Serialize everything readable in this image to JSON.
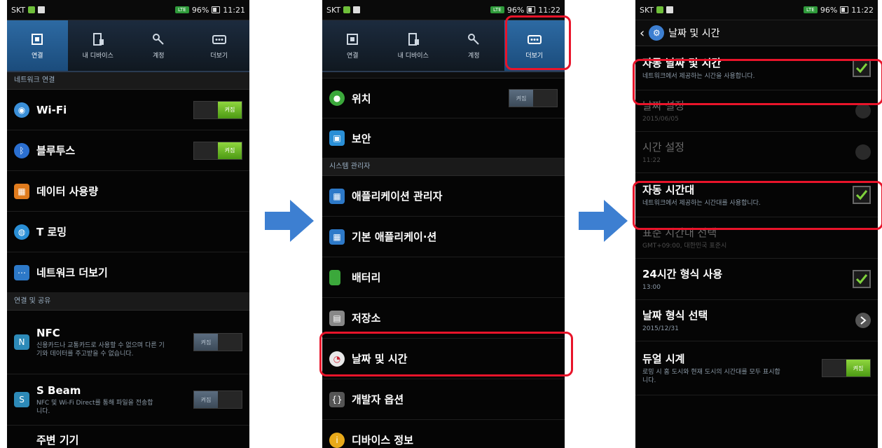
{
  "status": {
    "p1": {
      "carrier": "SKT",
      "battery": "96%",
      "time": "11:21"
    },
    "p2": {
      "carrier": "SKT",
      "battery": "96%",
      "time": "11:22"
    },
    "p3": {
      "carrier": "SKT",
      "battery": "96%",
      "time": "11:22"
    }
  },
  "tabs": [
    {
      "label": "연결",
      "icon": "connection-icon"
    },
    {
      "label": "내 디바이스",
      "icon": "device-icon"
    },
    {
      "label": "계정",
      "icon": "key-icon"
    },
    {
      "label": "더보기",
      "icon": "more-icon"
    }
  ],
  "p1": {
    "sections": [
      "네트워크 연결",
      "연결 및 공유"
    ],
    "items": [
      {
        "label": "Wi-Fi",
        "toggle": "켜짐",
        "color": "#3a8fd8"
      },
      {
        "label": "블루투스",
        "toggle": "켜짐",
        "color": "#2b6fd0"
      },
      {
        "label": "데이터 사용량",
        "color": "#e07b1d"
      },
      {
        "label": "T 로밍",
        "color": "#2a8fd6"
      },
      {
        "label": "네트워크 더보기",
        "color": "#2d79c8"
      }
    ],
    "nfc": {
      "label": "NFC",
      "sub": "신용카드나 교통카드로 사용할 수 없으며 다른 기기와 데이터를 주고받을 수 없습니다.",
      "toggle": "켜짐"
    },
    "sbeam": {
      "label": "S Beam",
      "sub": "NFC 및 Wi-Fi Direct를 통해 파일을 전송합니다.",
      "toggle": "켜짐"
    },
    "nearby": {
      "label": "주변 기기"
    }
  },
  "p2": {
    "location": {
      "label": "위치",
      "toggle": "켜짐"
    },
    "security": {
      "label": "보안"
    },
    "section": "시스템 관리자",
    "items": [
      {
        "label": "애플리케이션 관리자",
        "color": "#2d79c8"
      },
      {
        "label": "기본 애플리케이·션",
        "color": "#2d79c8"
      },
      {
        "label": "배터리",
        "color": "#3ba83b"
      },
      {
        "label": "저장소",
        "color": "#888888"
      },
      {
        "label": "날짜 및 시간",
        "color": "#e8e8e8"
      },
      {
        "label": "개발자 옵션",
        "color": "#777777"
      },
      {
        "label": "디바이스 정보",
        "color": "#e8a91a"
      }
    ]
  },
  "p3": {
    "title": "날짜 및 시간",
    "auto_datetime": {
      "label": "자동 날짜 및 시간",
      "sub": "네트워크에서 제공하는 시간을 사용합니다."
    },
    "set_date": {
      "label": "날짜 설정",
      "sub": "2015/06/05"
    },
    "set_time": {
      "label": "시간 설정",
      "sub": "11:22"
    },
    "auto_tz": {
      "label": "자동 시간대",
      "sub": "네트워크에서 제공하는 시간대를 사용합니다."
    },
    "select_tz": {
      "label": "표준 시간대 선택",
      "sub": "GMT+09:00, 대한민국 표준시"
    },
    "use24": {
      "label": "24시간 형식 사용",
      "sub": "13:00"
    },
    "date_format": {
      "label": "날짜 형식 선택",
      "sub": "2015/12/31"
    },
    "dual_clock": {
      "label": "듀얼 시계",
      "sub": "로밍 시 홈 도시와 현재 도시의 시간대를 모두 표시합니다.",
      "toggle": "켜짐"
    }
  },
  "colors": {
    "highlight": "#e8142a",
    "arrow": "#3d7fd1",
    "check": "#7fd23c"
  }
}
